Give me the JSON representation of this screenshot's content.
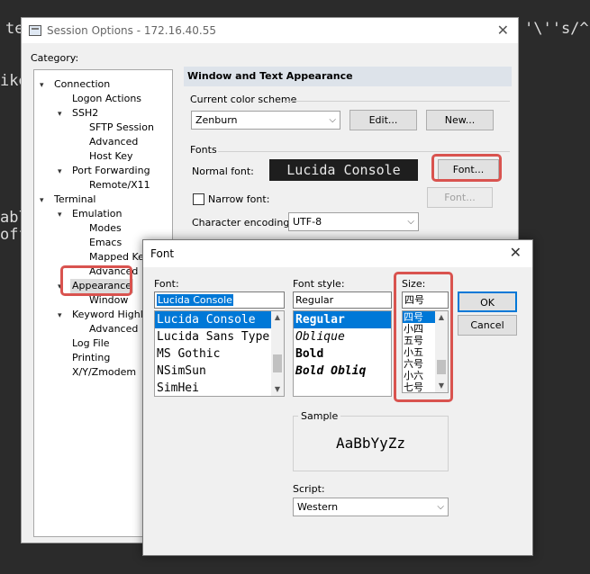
{
  "terminal_fragments": [
    "te",
    "'\\''s/^",
    "ike",
    "abl",
    "off"
  ],
  "session": {
    "title": "Session Options - 172.16.40.55",
    "category_label": "Category:",
    "tree": [
      {
        "label": "Connection",
        "toggle": "minus"
      },
      {
        "label": "Logon Actions"
      },
      {
        "label": "SSH2",
        "toggle": "minus"
      },
      {
        "label": "SFTP Session"
      },
      {
        "label": "Advanced"
      },
      {
        "label": "Host Key"
      },
      {
        "label": "Port Forwarding",
        "toggle": "minus"
      },
      {
        "label": "Remote/X11"
      },
      {
        "label": "Terminal",
        "toggle": "minus"
      },
      {
        "label": "Emulation",
        "toggle": "minus"
      },
      {
        "label": "Modes"
      },
      {
        "label": "Emacs"
      },
      {
        "label": "Mapped Keys"
      },
      {
        "label": "Advanced"
      },
      {
        "label": "Appearance",
        "toggle": "minus",
        "selected": true
      },
      {
        "label": "Window"
      },
      {
        "label": "Keyword Highlight",
        "toggle": "minus"
      },
      {
        "label": "Advanced"
      },
      {
        "label": "Log File"
      },
      {
        "label": "Printing"
      },
      {
        "label": "X/Y/Zmodem"
      }
    ],
    "panel_title": "Window and Text Appearance",
    "color_scheme_label": "Current color scheme",
    "color_scheme_value": "Zenburn",
    "edit_button": "Edit...",
    "new_button": "New...",
    "fonts_group": "Fonts",
    "normal_font_label": "Normal font:",
    "normal_font_preview": "Lucida Console",
    "font_button": "Font...",
    "narrow_font_label": "Narrow font:",
    "narrow_font_button": "Font...",
    "encoding_label": "Character encoding:",
    "encoding_value": "UTF-8"
  },
  "font_dialog": {
    "title": "Font",
    "font_label": "Font:",
    "font_value": "Lucida Console",
    "fonts": [
      "Lucida Console",
      "Lucida Sans Type",
      "MS Gothic",
      "NSimSun",
      "SimHei"
    ],
    "style_label": "Font style:",
    "style_value": "Regular",
    "styles": [
      "Regular",
      "Oblique",
      "Bold",
      "Bold Obliq"
    ],
    "size_label": "Size:",
    "size_value": "四号",
    "sizes": [
      "四号",
      "小四",
      "五号",
      "小五",
      "六号",
      "小六",
      "七号"
    ],
    "ok_button": "OK",
    "cancel_button": "Cancel",
    "sample_label": "Sample",
    "sample_text": "AaBbYyZz",
    "script_label": "Script:",
    "script_value": "Western"
  },
  "colors": {
    "highlight": "#d9534f",
    "selection": "#0078d7"
  }
}
